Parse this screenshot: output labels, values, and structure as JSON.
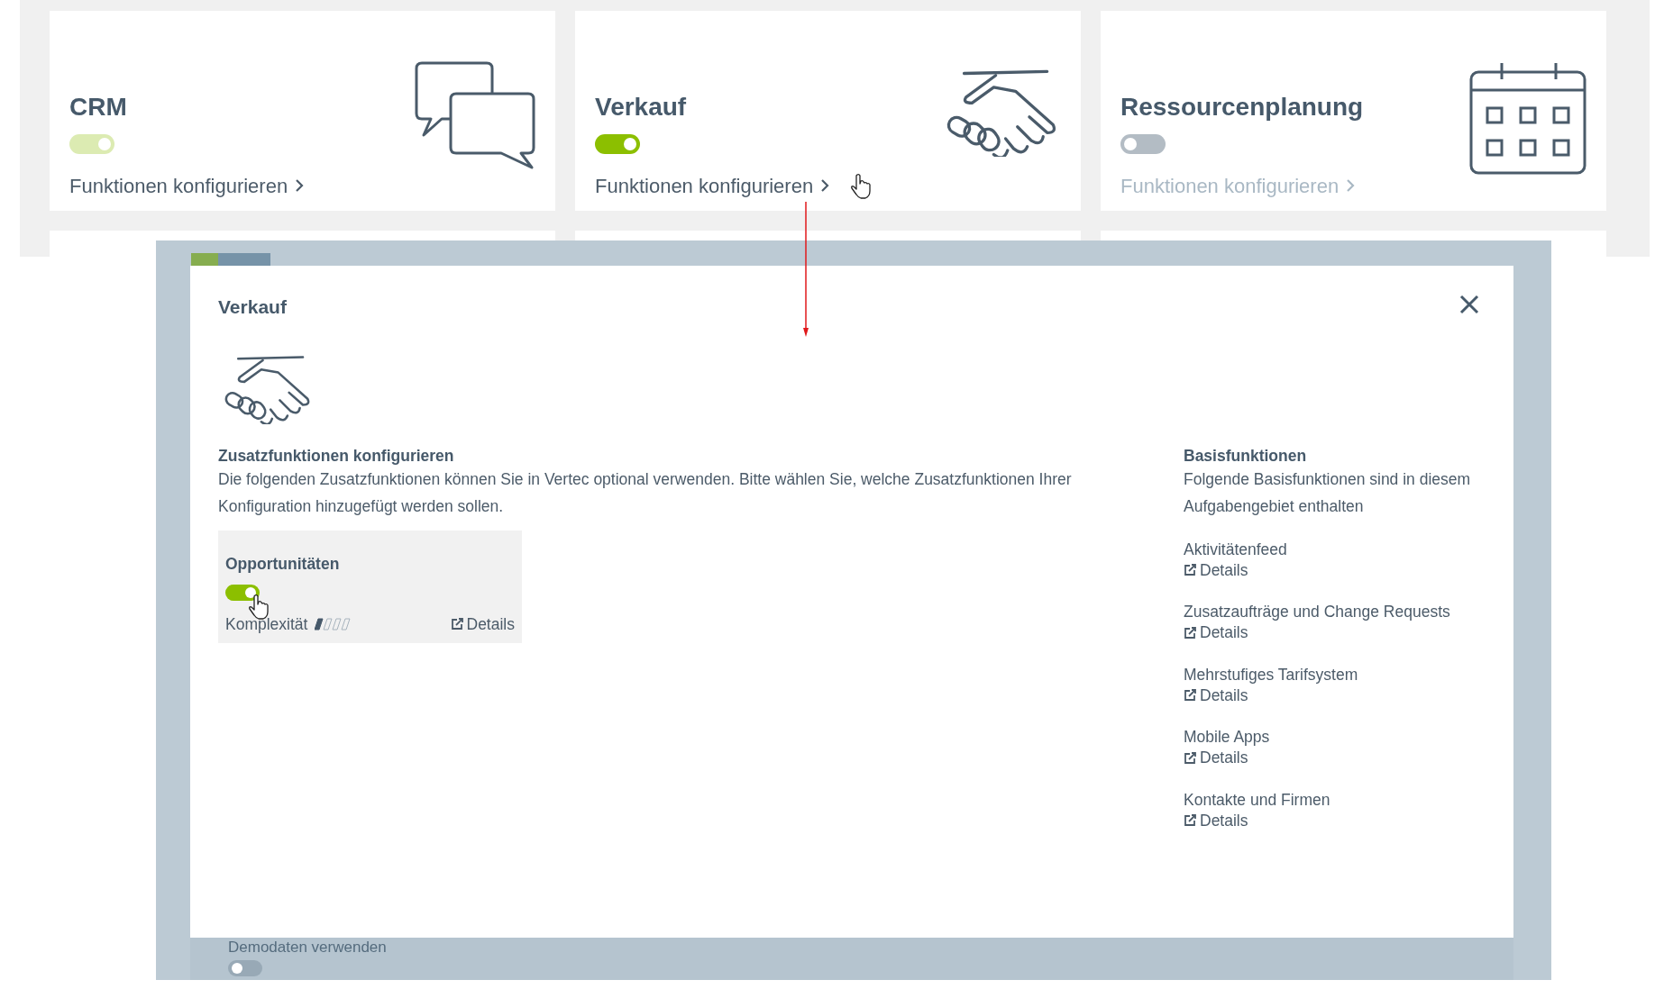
{
  "cards": [
    {
      "title": "CRM",
      "kind": "chat",
      "on": true,
      "locked": true,
      "link": "Funktionen konfigurieren"
    },
    {
      "title": "Verkauf",
      "kind": "handshake",
      "on": true,
      "locked": false,
      "link": "Funktionen konfigurieren"
    },
    {
      "title": "Ressourcenplanung",
      "kind": "calendar",
      "on": false,
      "locked": false,
      "link": "Funktionen konfigurieren"
    }
  ],
  "modal": {
    "title": "Verkauf",
    "extras_heading": "Zusatzfunktionen konfigurieren",
    "extras_text": "Die folgenden Zusatzfunktionen können Sie in Vertec optional verwenden. Bitte wählen Sie, welche Zusatzfunktionen Ihrer Konfiguration hinzugefügt werden sollen.",
    "extras": [
      {
        "name": "Opportunitäten",
        "on": true,
        "complexity_label": "Komplexität",
        "level": 0.25,
        "details": "Details"
      }
    ],
    "base_heading": "Basisfunktionen",
    "base_text": "Folgende Basisfunktionen sind in diesem Aufgabengebiet enthalten",
    "base": [
      {
        "name": "Aktivitätenfeed",
        "details": "Details"
      },
      {
        "name": "Zusatzaufträge und Change Requests",
        "details": "Details"
      },
      {
        "name": "Mehrstufiges Tarifsystem",
        "details": "Details"
      },
      {
        "name": "Mobile Apps",
        "details": "Details"
      },
      {
        "name": "Kontakte und Firmen",
        "details": "Details"
      }
    ]
  },
  "background_setting": {
    "label": "Demodaten verwenden",
    "on": false
  }
}
